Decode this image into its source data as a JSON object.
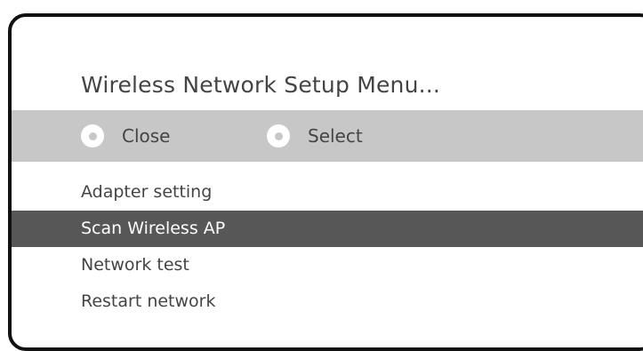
{
  "dialog": {
    "title": "Wireless Network Setup Menu..."
  },
  "actions": {
    "close_label": "Close",
    "select_label": "Select",
    "close_icon": "radio-button-icon",
    "select_icon": "radio-button-icon"
  },
  "menu": {
    "items": [
      {
        "label": "Adapter setting",
        "selected": false
      },
      {
        "label": "Scan Wireless AP",
        "selected": true
      },
      {
        "label": "Network test",
        "selected": false
      },
      {
        "label": "Restart network",
        "selected": false
      }
    ]
  },
  "colors": {
    "frame_border": "#111111",
    "action_bar": "#c7c7c7",
    "selected_row": "#575757",
    "text": "#444444",
    "selected_text": "#ffffff"
  }
}
